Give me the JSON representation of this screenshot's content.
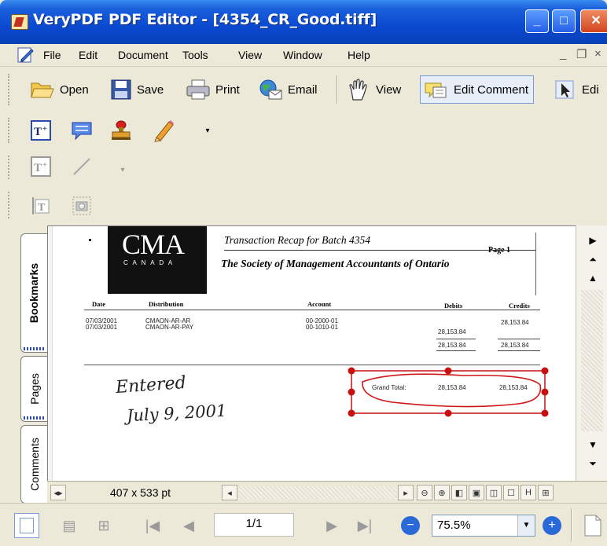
{
  "window": {
    "title": "VeryPDF PDF Editor - [4354_CR_Good.tiff]",
    "controls": {
      "minimize": "_",
      "maximize": "□",
      "close": "✕"
    }
  },
  "menubar": {
    "items": [
      "File",
      "Edit",
      "Document",
      "Tools",
      "View",
      "Window",
      "Help"
    ],
    "mdi_minimize": "_",
    "mdi_restore": "❐",
    "mdi_close": "×"
  },
  "toolbar_main": {
    "open": "Open",
    "save": "Save",
    "print": "Print",
    "email": "Email",
    "view": "View",
    "edit_comment": "Edit Comment",
    "edit_truncated": "Edi"
  },
  "sidetabs": [
    "Bookmarks",
    "Pages",
    "Comments"
  ],
  "document": {
    "logo_main": "CMA",
    "logo_sub": "C A N A D A",
    "heading1": "Transaction Recap for Batch 4354",
    "page_label": "Page 1",
    "heading2": "The Society of Management Accountants of Ontario",
    "columns": [
      "Date",
      "Distribution",
      "Account",
      "Debits",
      "Credits"
    ],
    "rows": [
      {
        "date": "07/03/2001",
        "distribution": "CMAON-AR-AR",
        "account": "00-2000-01",
        "debit": "",
        "credit": "28,153.84"
      },
      {
        "date": "07/03/2001",
        "distribution": "CMAON-AR-PAY",
        "account": "00-1010-01",
        "debit": "28,153.84",
        "credit": ""
      }
    ],
    "subtotal_debit": "28,153.84",
    "subtotal_credit": "28,153.84",
    "grand_total_label": "Grand Total:",
    "grand_total_debit": "28,153.84",
    "grand_total_credit": "28,153.84",
    "handwriting_line1": "Entered",
    "handwriting_line2": "July 9, 2001"
  },
  "statusbar": {
    "page_size": "407 x 533 pt"
  },
  "navbar": {
    "page_indicator": "1/1",
    "zoom": "75.5%"
  },
  "colors": {
    "title_bar": "#0a49d0",
    "annotation_red": "#d01818",
    "annotation_handle": "#c81010",
    "highlight_blue": "#7b9ad6"
  }
}
